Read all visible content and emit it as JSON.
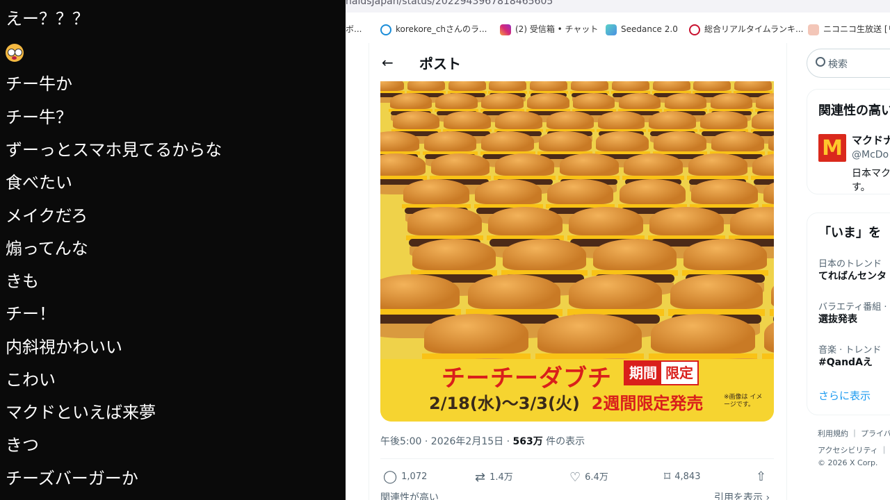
{
  "comments": [
    "えー？？？",
    "",
    "チー牛か",
    "チー牛？",
    "ずーっとスマホ見てるからな",
    "食べたい",
    "メイクだろ",
    "煽ってんな",
    "きも",
    "チー！",
    "内斜視かわいい",
    "こわい",
    "マクドといえば来夢",
    "きつ",
    "チーズバーガーか"
  ],
  "browser": {
    "url": "naldsJapan/status/2022943967818465605",
    "bookmarks": [
      {
        "label": "ボ...",
        "icon": "folder-icon"
      },
      {
        "label": "korekore_chさんのラ...",
        "icon": "cloud-icon",
        "color": "#1a8cd8"
      },
      {
        "label": "(2) 受信箱 • チャット",
        "icon": "instagram-icon",
        "color": "#d62976"
      },
      {
        "label": "Seedance 2.0",
        "icon": "seedance-icon",
        "color": "#4a90e2"
      },
      {
        "label": "総合リアルタイムランキ...",
        "icon": "crown-icon",
        "color": "#c8102e"
      },
      {
        "label": "ニコニコ生放送 [リ...",
        "icon": "niconico-icon",
        "color": "#e8a08a"
      }
    ]
  },
  "post": {
    "back": "←",
    "title": "ポスト",
    "promo": {
      "name": "チーチーダブチ",
      "limited_a": "期間",
      "limited_b": "限定",
      "dates": "2/18(水)〜3/3(火)",
      "dates_tail": "2週間限定発売",
      "note": "※画像は イメージです。"
    },
    "meta_time": "午後5:00 · 2026年2月15日 · ",
    "meta_views": "563万",
    "meta_suffix": " 件の表示",
    "actions": {
      "replies": "1,072",
      "reposts": "1.4万",
      "likes": "6.4万",
      "bookmarks": "4,843"
    },
    "below_left": "関連性が高い",
    "below_right": "引用を表示 ›"
  },
  "sidebar": {
    "search_placeholder": "検索",
    "relevant_title": "関連性の高い",
    "account_name": "マクドナ",
    "account_handle": "@McDo",
    "account_bio1": "日本マク",
    "account_bio2": "す。",
    "trends_title": "「いま」を",
    "trends": [
      {
        "category": "日本のトレンド",
        "name": "てればんセンタ"
      },
      {
        "category": "バラエティ番組 ·",
        "name": "選抜発表"
      },
      {
        "category": "音楽 · トレンド",
        "name": "#QandAえ"
      }
    ],
    "show_more": "さらに表示",
    "footer1": "利用規約 ｜ プライバ",
    "footer2": "アクセシビリティ ｜",
    "footer3": "© 2026 X Corp."
  }
}
